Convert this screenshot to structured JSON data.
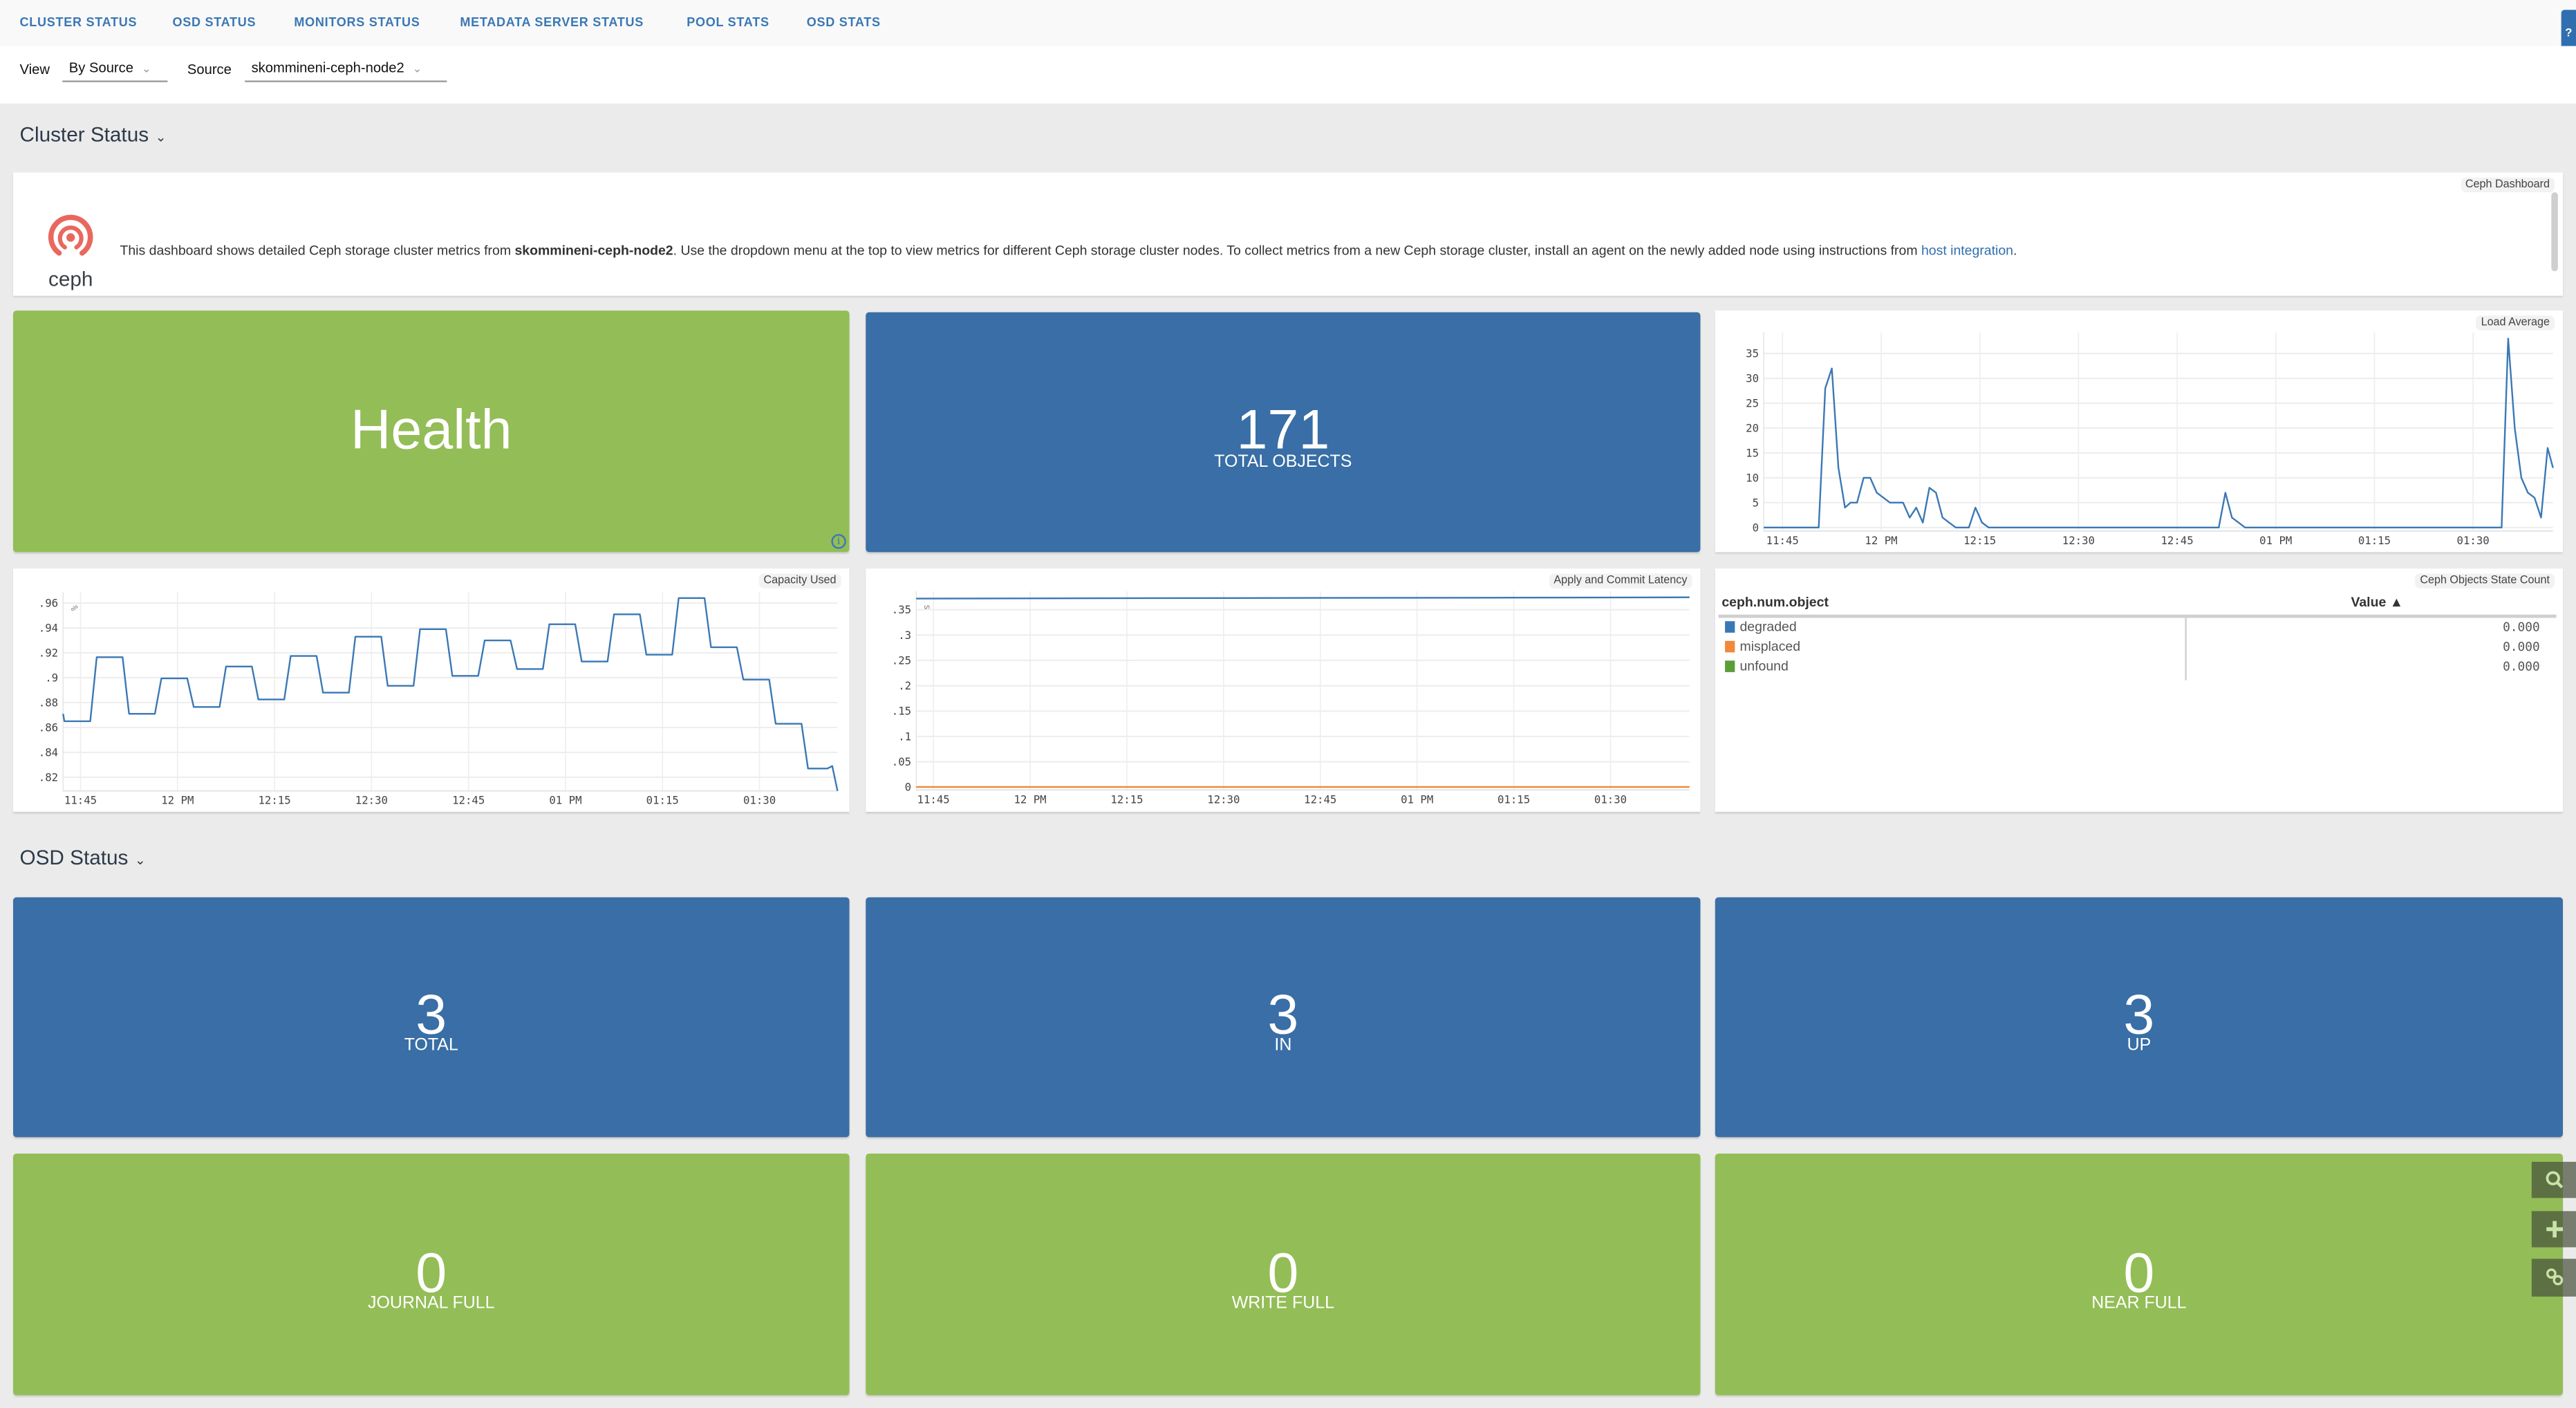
{
  "nav": {
    "tabs": [
      "CLUSTER STATUS",
      "OSD STATUS",
      "MONITORS STATUS",
      "METADATA SERVER STATUS",
      "POOL STATS",
      "OSD STATS"
    ]
  },
  "filters": {
    "view_label": "View",
    "view_value": "By Source",
    "source_label": "Source",
    "source_value": "skommineni-ceph-node2"
  },
  "help_button": "?",
  "cluster_section": {
    "title": "Cluster Status",
    "info": {
      "tag": "Ceph Dashboard",
      "logo_text": "ceph",
      "text_before": "This dashboard shows detailed Ceph storage cluster metrics from ",
      "text_bold": "skommineni-ceph-node2",
      "text_after": ". Use the dropdown menu at the top to view metrics for different Ceph storage cluster nodes. To collect metrics from a new Ceph storage cluster, install an agent on the newly added node using instructions from ",
      "link": "host integration",
      "text_end": "."
    },
    "health": {
      "label": "Health",
      "color": "#93bd56"
    },
    "total_objects": {
      "value": "171",
      "label": "TOTAL OBJECTS",
      "color": "#396ea6"
    },
    "objects_table": {
      "title": "Ceph Objects State Count",
      "col1": "ceph.num.object",
      "col2": "Value ▲",
      "rows": [
        {
          "name": "degraded",
          "value": "0.000",
          "color": "#3a78b5"
        },
        {
          "name": "misplaced",
          "value": "0.000",
          "color": "#f0893a"
        },
        {
          "name": "unfound",
          "value": "0.000",
          "color": "#5a9e3a"
        }
      ]
    }
  },
  "osd_section": {
    "title": "OSD Status",
    "tiles": [
      {
        "value": "3",
        "label": "TOTAL",
        "color": "#396ea6"
      },
      {
        "value": "3",
        "label": "IN",
        "color": "#396ea6"
      },
      {
        "value": "3",
        "label": "UP",
        "color": "#396ea6"
      },
      {
        "value": "0",
        "label": "JOURNAL FULL",
        "color": "#93bd56"
      },
      {
        "value": "0",
        "label": "WRITE FULL",
        "color": "#93bd56"
      },
      {
        "value": "0",
        "label": "NEAR FULL",
        "color": "#93bd56"
      }
    ]
  },
  "side_tools": [
    "search-icon",
    "plus-icon",
    "link-icon"
  ],
  "chart_data": [
    {
      "type": "line",
      "title": "Load Average",
      "ylabel": "",
      "xlabel": "",
      "grid": true,
      "xlim": [
        "11:42:09",
        "13:42:09"
      ],
      "ylim": [
        -0.69,
        39.26
      ],
      "x_ticks": [
        [
          "11:45",
          "11:45"
        ],
        [
          "12:00",
          "12 PM"
        ],
        [
          "12:15",
          "12:15"
        ],
        [
          "12:30",
          "12:30"
        ],
        [
          "12:45",
          "12:45"
        ],
        [
          "13:00",
          "01 PM"
        ],
        [
          "13:15",
          "01:15"
        ],
        [
          "13:30",
          "01:30"
        ]
      ],
      "y_ticks": [
        [
          0,
          "0"
        ],
        [
          5,
          "5"
        ],
        [
          10,
          "10"
        ],
        [
          15,
          "15"
        ],
        [
          20,
          "20"
        ],
        [
          25,
          "25"
        ],
        [
          30,
          "30"
        ],
        [
          35,
          "35"
        ]
      ],
      "series": [
        {
          "color": "#3a78b5",
          "points": [
            [
              "11:42:09",
              0
            ],
            [
              "11:50:30",
              0
            ],
            [
              "11:51:30",
              28
            ],
            [
              "11:52:30",
              32
            ],
            [
              "11:53:30",
              12
            ],
            [
              "11:54:30",
              4
            ],
            [
              "11:55:20",
              5
            ],
            [
              "11:56:20",
              5
            ],
            [
              "11:57:20",
              10
            ],
            [
              "11:58:20",
              10
            ],
            [
              "11:59:20",
              7
            ],
            [
              "12:01:20",
              5
            ],
            [
              "12:03:20",
              5
            ],
            [
              "12:04:20",
              2
            ],
            [
              "12:05:20",
              4
            ],
            [
              "12:06:20",
              1
            ],
            [
              "12:07:20",
              8
            ],
            [
              "12:08:20",
              7
            ],
            [
              "12:09:20",
              2
            ],
            [
              "12:11:20",
              0
            ],
            [
              "12:13:20",
              0
            ],
            [
              "12:14:20",
              4
            ],
            [
              "12:15:20",
              1
            ],
            [
              "12:16:20",
              0
            ],
            [
              "12:51:20",
              0
            ],
            [
              "12:52:20",
              7
            ],
            [
              "12:53:20",
              2
            ],
            [
              "12:55:20",
              0
            ],
            [
              "13:34:20",
              0
            ],
            [
              "13:35:20",
              38
            ],
            [
              "13:36:20",
              20
            ],
            [
              "13:37:20",
              10
            ],
            [
              "13:38:20",
              7
            ],
            [
              "13:39:20",
              6
            ],
            [
              "13:40:20",
              2
            ],
            [
              "13:41:20",
              16
            ],
            [
              "13:42:09",
              12
            ]
          ]
        }
      ]
    },
    {
      "type": "line",
      "title": "Capacity Used",
      "ylabel": "%",
      "xlabel": "",
      "grid": true,
      "xlim": [
        "11:42:18",
        "13:42:04"
      ],
      "ylim": [
        0.809,
        0.9687
      ],
      "x_ticks": [
        [
          "11:45",
          "11:45"
        ],
        [
          "12:00",
          "12 PM"
        ],
        [
          "12:15",
          "12:15"
        ],
        [
          "12:30",
          "12:30"
        ],
        [
          "12:45",
          "12:45"
        ],
        [
          "13:00",
          "01 PM"
        ],
        [
          "13:15",
          "01:15"
        ],
        [
          "13:30",
          "01:30"
        ]
      ],
      "y_ticks": [
        [
          0.82,
          ".82"
        ],
        [
          0.84,
          ".84"
        ],
        [
          0.86,
          ".86"
        ],
        [
          0.88,
          ".88"
        ],
        [
          0.9,
          ".9"
        ],
        [
          0.92,
          ".92"
        ],
        [
          0.94,
          ".94"
        ],
        [
          0.96,
          ".96"
        ]
      ],
      "series": [
        {
          "color": "#3a78b5",
          "points": [
            [
              "11:42:18",
              0.871
            ],
            [
              "11:42:30",
              0.865
            ],
            [
              "11:46:30",
              0.865
            ],
            [
              "11:47:30",
              0.9165
            ],
            [
              "11:51:30",
              0.9165
            ],
            [
              "11:52:30",
              0.871
            ],
            [
              "11:56:30",
              0.871
            ],
            [
              "11:57:30",
              0.8995
            ],
            [
              "12:01:30",
              0.8995
            ],
            [
              "12:02:30",
              0.8765
            ],
            [
              "12:06:30",
              0.8765
            ],
            [
              "12:07:30",
              0.909
            ],
            [
              "12:11:30",
              0.909
            ],
            [
              "12:12:30",
              0.8825
            ],
            [
              "12:16:30",
              0.8825
            ],
            [
              "12:17:30",
              0.9175
            ],
            [
              "12:21:30",
              0.9175
            ],
            [
              "12:22:30",
              0.888
            ],
            [
              "12:26:30",
              0.888
            ],
            [
              "12:27:30",
              0.933
            ],
            [
              "12:31:30",
              0.933
            ],
            [
              "12:32:30",
              0.8935
            ],
            [
              "12:36:30",
              0.8935
            ],
            [
              "12:37:30",
              0.939
            ],
            [
              "12:41:30",
              0.939
            ],
            [
              "12:42:30",
              0.9015
            ],
            [
              "12:46:30",
              0.9015
            ],
            [
              "12:47:30",
              0.93
            ],
            [
              "12:51:30",
              0.93
            ],
            [
              "12:52:30",
              0.907
            ],
            [
              "12:56:30",
              0.907
            ],
            [
              "12:57:30",
              0.943
            ],
            [
              "13:01:30",
              0.943
            ],
            [
              "13:02:30",
              0.913
            ],
            [
              "13:06:30",
              0.913
            ],
            [
              "13:07:30",
              0.951
            ],
            [
              "13:11:30",
              0.951
            ],
            [
              "13:12:30",
              0.9185
            ],
            [
              "13:16:30",
              0.9185
            ],
            [
              "13:17:30",
              0.964
            ],
            [
              "13:21:30",
              0.964
            ],
            [
              "13:22:30",
              0.9245
            ],
            [
              "13:26:30",
              0.9245
            ],
            [
              "13:27:30",
              0.8985
            ],
            [
              "13:31:30",
              0.8985
            ],
            [
              "13:32:30",
              0.863
            ],
            [
              "13:36:30",
              0.863
            ],
            [
              "13:37:30",
              0.827
            ],
            [
              "13:40:30",
              0.827
            ],
            [
              "13:41:15",
              0.829
            ],
            [
              "13:42:04",
              0.809
            ]
          ]
        }
      ]
    },
    {
      "type": "line",
      "title": "Apply and Commit Latency",
      "ylabel": "s",
      "xlabel": "",
      "grid": true,
      "xlim": [
        "11:42:20",
        "13:42:15"
      ],
      "ylim": [
        -0.0055,
        0.3864
      ],
      "x_ticks": [
        [
          "11:45",
          "11:45"
        ],
        [
          "12:00",
          "12 PM"
        ],
        [
          "12:15",
          "12:15"
        ],
        [
          "12:30",
          "12:30"
        ],
        [
          "12:45",
          "12:45"
        ],
        [
          "13:00",
          "01 PM"
        ],
        [
          "13:15",
          "01:15"
        ],
        [
          "13:30",
          "01:30"
        ]
      ],
      "y_ticks": [
        [
          0,
          "0"
        ],
        [
          0.05,
          ".05"
        ],
        [
          0.1,
          ".1"
        ],
        [
          0.15,
          ".15"
        ],
        [
          0.2,
          ".2"
        ],
        [
          0.25,
          ".25"
        ],
        [
          0.3,
          ".3"
        ],
        [
          0.35,
          ".35"
        ]
      ],
      "series": [
        {
          "color": "#3a78b5",
          "points": [
            [
              "11:42:20",
              0.372
            ],
            [
              "12:30:00",
              0.373
            ],
            [
              "13:15:00",
              0.3738
            ],
            [
              "13:42:15",
              0.3745
            ]
          ]
        },
        {
          "color": "#f0893a",
          "points": [
            [
              "11:42:20",
              0.0005
            ],
            [
              "13:42:15",
              0.0005
            ]
          ]
        }
      ]
    }
  ]
}
